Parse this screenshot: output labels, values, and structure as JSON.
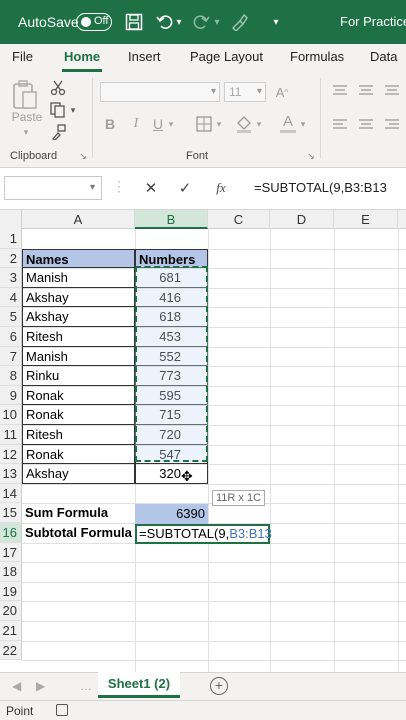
{
  "titlebar": {
    "autosave_label": "AutoSave",
    "autosave_state": "Off",
    "filename": "For Practice.",
    "accent": "#1e7145"
  },
  "ribbon_tabs": [
    "File",
    "Home",
    "Insert",
    "Page Layout",
    "Formulas",
    "Data"
  ],
  "ribbon": {
    "paste_label": "Paste",
    "group_clipboard": "Clipboard",
    "group_font": "Font",
    "font_size": "11",
    "bold": "B",
    "italic": "I",
    "underline": "U"
  },
  "formula_bar": {
    "name_box": "",
    "cancel": "✕",
    "enter": "✓",
    "fx": "fx",
    "formula": "=SUBTOTAL(9,B3:B13"
  },
  "grid": {
    "columns": [
      "A",
      "B",
      "C",
      "D",
      "E"
    ],
    "rows": [
      "1",
      "2",
      "3",
      "4",
      "5",
      "6",
      "7",
      "8",
      "9",
      "10",
      "11",
      "12",
      "13",
      "14",
      "15",
      "16",
      "17",
      "18",
      "19",
      "20",
      "21",
      "22"
    ],
    "header": {
      "names": "Names",
      "numbers": "Numbers"
    },
    "data": [
      {
        "name": "Manish",
        "value": "681"
      },
      {
        "name": "Akshay",
        "value": "416"
      },
      {
        "name": "Akshay",
        "value": "618"
      },
      {
        "name": "Ritesh",
        "value": "453"
      },
      {
        "name": "Manish",
        "value": "552"
      },
      {
        "name": "Rinku",
        "value": "773"
      },
      {
        "name": "Ronak",
        "value": "595"
      },
      {
        "name": "Ronak",
        "value": "715"
      },
      {
        "name": "Ritesh",
        "value": "720"
      },
      {
        "name": "Ronak",
        "value": "547"
      },
      {
        "name": "Akshay",
        "value": "320"
      }
    ],
    "sum_label": "Sum Formula",
    "sum_value": "6390",
    "subtotal_label": "Subtotal Formula",
    "active_formula_prefix": "=SUBTOTAL(9,",
    "active_formula_ref": "B3:B13",
    "size_tooltip": "11R x 1C"
  },
  "sheets": {
    "active": "Sheet1 (2)",
    "add": "+"
  },
  "status": {
    "mode": "Point"
  }
}
